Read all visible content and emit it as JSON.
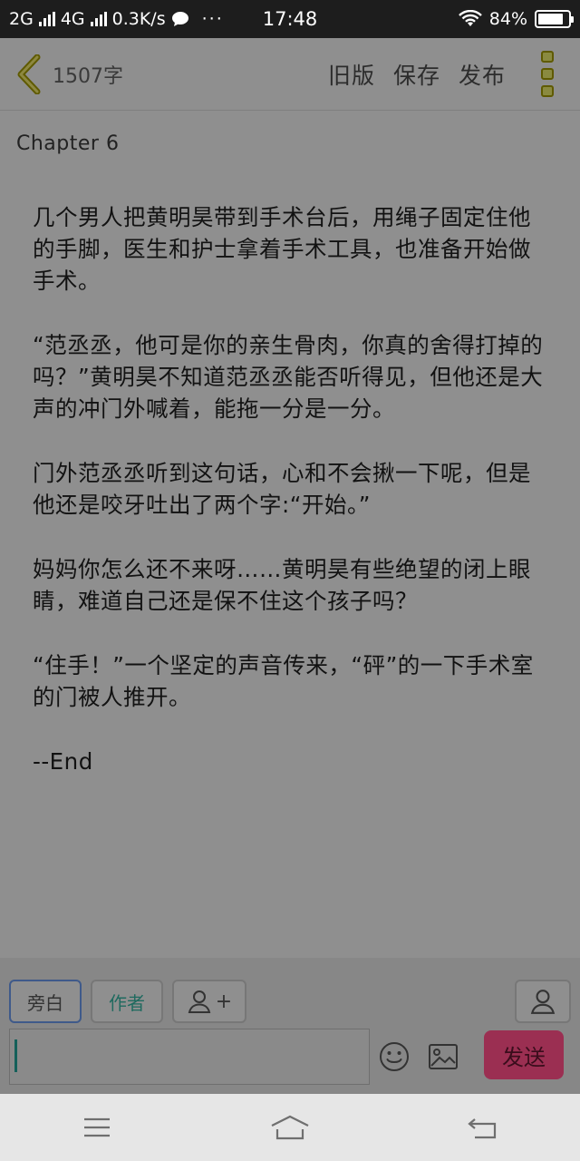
{
  "status_bar": {
    "network_1": "2G",
    "network_2": "4G",
    "speed": "0.3K/s",
    "more": "···",
    "time": "17:48",
    "battery": "84%",
    "battery_level": 0.84
  },
  "header": {
    "word_count": "1507字",
    "actions": [
      "旧版",
      "保存",
      "发布"
    ]
  },
  "chapter_title": "Chapter  6",
  "paragraphs": [
    "几个男人把黄明昊带到手术台后，用绳子固定住他的手脚，医生和护士拿着手术工具，也准备开始做手术。",
    "“范丞丞，他可是你的亲生骨肉，你真的舍得打掉的吗？”黄明昊不知道范丞丞能否听得见，但他还是大声的冲门外喊着，能拖一分是一分。",
    "门外范丞丞听到这句话，心和不会揪一下呢，但是他还是咬牙吐出了两个字:“开始。”",
    "妈妈你怎么还不来呀……黄明昊有些绝望的闭上眼睛，难道自己还是保不住这个孩子吗？",
    "“住手！”一个坚定的声音传来，“砰”的一下手术室的门被人推开。",
    "--End"
  ],
  "composer": {
    "roles": [
      "旁白",
      "作者"
    ],
    "add_role_symbol": "+",
    "input_value": "",
    "send_label": "发送"
  },
  "colors": {
    "overlay_gray": "#8f8f8f",
    "send_button": "#9b2f52",
    "accent_green": "#14605a"
  }
}
